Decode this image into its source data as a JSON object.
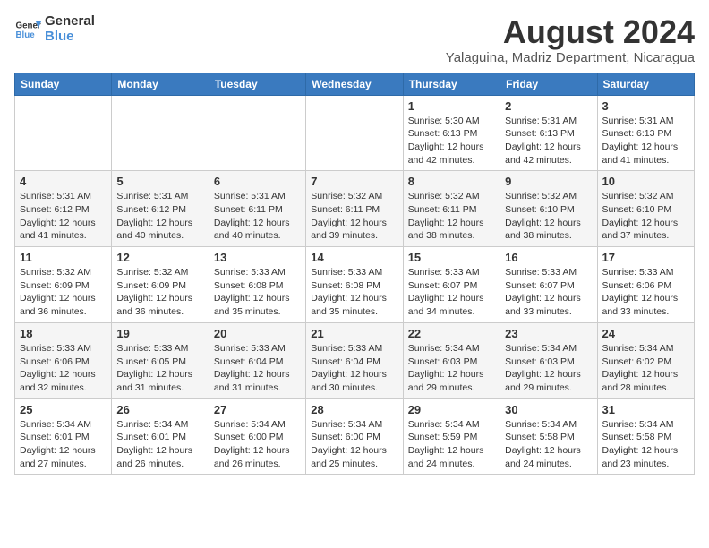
{
  "logo": {
    "text_general": "General",
    "text_blue": "Blue"
  },
  "title": "August 2024",
  "subtitle": "Yalaguina, Madriz Department, Nicaragua",
  "weekdays": [
    "Sunday",
    "Monday",
    "Tuesday",
    "Wednesday",
    "Thursday",
    "Friday",
    "Saturday"
  ],
  "weeks": [
    [
      {
        "day": "",
        "info": ""
      },
      {
        "day": "",
        "info": ""
      },
      {
        "day": "",
        "info": ""
      },
      {
        "day": "",
        "info": ""
      },
      {
        "day": "1",
        "info": "Sunrise: 5:30 AM\nSunset: 6:13 PM\nDaylight: 12 hours\nand 42 minutes."
      },
      {
        "day": "2",
        "info": "Sunrise: 5:31 AM\nSunset: 6:13 PM\nDaylight: 12 hours\nand 42 minutes."
      },
      {
        "day": "3",
        "info": "Sunrise: 5:31 AM\nSunset: 6:13 PM\nDaylight: 12 hours\nand 41 minutes."
      }
    ],
    [
      {
        "day": "4",
        "info": "Sunrise: 5:31 AM\nSunset: 6:12 PM\nDaylight: 12 hours\nand 41 minutes."
      },
      {
        "day": "5",
        "info": "Sunrise: 5:31 AM\nSunset: 6:12 PM\nDaylight: 12 hours\nand 40 minutes."
      },
      {
        "day": "6",
        "info": "Sunrise: 5:31 AM\nSunset: 6:11 PM\nDaylight: 12 hours\nand 40 minutes."
      },
      {
        "day": "7",
        "info": "Sunrise: 5:32 AM\nSunset: 6:11 PM\nDaylight: 12 hours\nand 39 minutes."
      },
      {
        "day": "8",
        "info": "Sunrise: 5:32 AM\nSunset: 6:11 PM\nDaylight: 12 hours\nand 38 minutes."
      },
      {
        "day": "9",
        "info": "Sunrise: 5:32 AM\nSunset: 6:10 PM\nDaylight: 12 hours\nand 38 minutes."
      },
      {
        "day": "10",
        "info": "Sunrise: 5:32 AM\nSunset: 6:10 PM\nDaylight: 12 hours\nand 37 minutes."
      }
    ],
    [
      {
        "day": "11",
        "info": "Sunrise: 5:32 AM\nSunset: 6:09 PM\nDaylight: 12 hours\nand 36 minutes."
      },
      {
        "day": "12",
        "info": "Sunrise: 5:32 AM\nSunset: 6:09 PM\nDaylight: 12 hours\nand 36 minutes."
      },
      {
        "day": "13",
        "info": "Sunrise: 5:33 AM\nSunset: 6:08 PM\nDaylight: 12 hours\nand 35 minutes."
      },
      {
        "day": "14",
        "info": "Sunrise: 5:33 AM\nSunset: 6:08 PM\nDaylight: 12 hours\nand 35 minutes."
      },
      {
        "day": "15",
        "info": "Sunrise: 5:33 AM\nSunset: 6:07 PM\nDaylight: 12 hours\nand 34 minutes."
      },
      {
        "day": "16",
        "info": "Sunrise: 5:33 AM\nSunset: 6:07 PM\nDaylight: 12 hours\nand 33 minutes."
      },
      {
        "day": "17",
        "info": "Sunrise: 5:33 AM\nSunset: 6:06 PM\nDaylight: 12 hours\nand 33 minutes."
      }
    ],
    [
      {
        "day": "18",
        "info": "Sunrise: 5:33 AM\nSunset: 6:06 PM\nDaylight: 12 hours\nand 32 minutes."
      },
      {
        "day": "19",
        "info": "Sunrise: 5:33 AM\nSunset: 6:05 PM\nDaylight: 12 hours\nand 31 minutes."
      },
      {
        "day": "20",
        "info": "Sunrise: 5:33 AM\nSunset: 6:04 PM\nDaylight: 12 hours\nand 31 minutes."
      },
      {
        "day": "21",
        "info": "Sunrise: 5:33 AM\nSunset: 6:04 PM\nDaylight: 12 hours\nand 30 minutes."
      },
      {
        "day": "22",
        "info": "Sunrise: 5:34 AM\nSunset: 6:03 PM\nDaylight: 12 hours\nand 29 minutes."
      },
      {
        "day": "23",
        "info": "Sunrise: 5:34 AM\nSunset: 6:03 PM\nDaylight: 12 hours\nand 29 minutes."
      },
      {
        "day": "24",
        "info": "Sunrise: 5:34 AM\nSunset: 6:02 PM\nDaylight: 12 hours\nand 28 minutes."
      }
    ],
    [
      {
        "day": "25",
        "info": "Sunrise: 5:34 AM\nSunset: 6:01 PM\nDaylight: 12 hours\nand 27 minutes."
      },
      {
        "day": "26",
        "info": "Sunrise: 5:34 AM\nSunset: 6:01 PM\nDaylight: 12 hours\nand 26 minutes."
      },
      {
        "day": "27",
        "info": "Sunrise: 5:34 AM\nSunset: 6:00 PM\nDaylight: 12 hours\nand 26 minutes."
      },
      {
        "day": "28",
        "info": "Sunrise: 5:34 AM\nSunset: 6:00 PM\nDaylight: 12 hours\nand 25 minutes."
      },
      {
        "day": "29",
        "info": "Sunrise: 5:34 AM\nSunset: 5:59 PM\nDaylight: 12 hours\nand 24 minutes."
      },
      {
        "day": "30",
        "info": "Sunrise: 5:34 AM\nSunset: 5:58 PM\nDaylight: 12 hours\nand 24 minutes."
      },
      {
        "day": "31",
        "info": "Sunrise: 5:34 AM\nSunset: 5:58 PM\nDaylight: 12 hours\nand 23 minutes."
      }
    ]
  ]
}
